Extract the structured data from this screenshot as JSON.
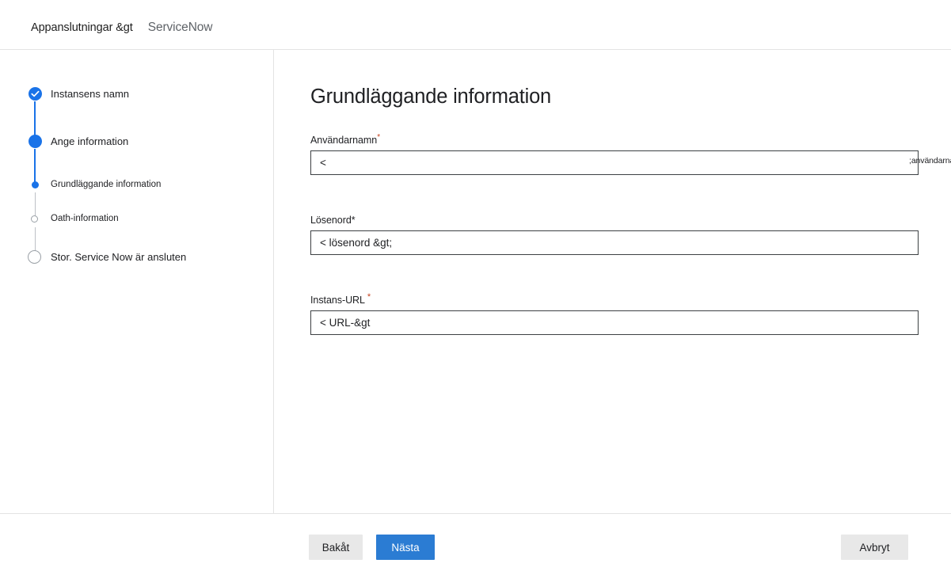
{
  "header": {
    "breadcrumb_parent": "Appanslutningar &gt",
    "breadcrumb_current": "ServiceNow"
  },
  "sidebar": {
    "steps": [
      {
        "label": "Instansens namn",
        "state": "completed",
        "marker": "check-circle-icon"
      },
      {
        "label": "Ange information",
        "state": "active",
        "marker": "filled-circle-icon"
      },
      {
        "label": "Grundläggande information",
        "state": "sub-active",
        "marker": "small-filled-circle-icon"
      },
      {
        "label": "Oath-information",
        "state": "sub-pending",
        "marker": "small-hollow-circle-icon"
      },
      {
        "label": "Stor. Service Now är ansluten",
        "state": "pending",
        "marker": "hollow-circle-icon"
      }
    ]
  },
  "main": {
    "title": "Grundläggande information",
    "fields": [
      {
        "label": "Användarnamn",
        "required_marker": "*",
        "required_style": "red-superscript",
        "value": "<",
        "overflow_value": ";användarnamn &gt"
      },
      {
        "label": "Lösenord",
        "required_marker": "*",
        "required_style": "black-inline",
        "value": "< lösenord &gt;",
        "overflow_value": ""
      },
      {
        "label": "Instans-URL",
        "required_marker": "*",
        "required_style": "red-superscript-spaced",
        "value": "< URL-&gt",
        "overflow_value": ""
      }
    ]
  },
  "footer": {
    "back_label": "Bakåt",
    "next_label": "Nästa",
    "cancel_label": "Avbryt"
  },
  "colors": {
    "accent_blue": "#1a73e8",
    "button_blue": "#2b7cd3",
    "required_red": "#c5411e",
    "pending_grey": "#9aa0a6",
    "divider": "#e3e3e3",
    "button_grey": "#e8e8e8"
  }
}
